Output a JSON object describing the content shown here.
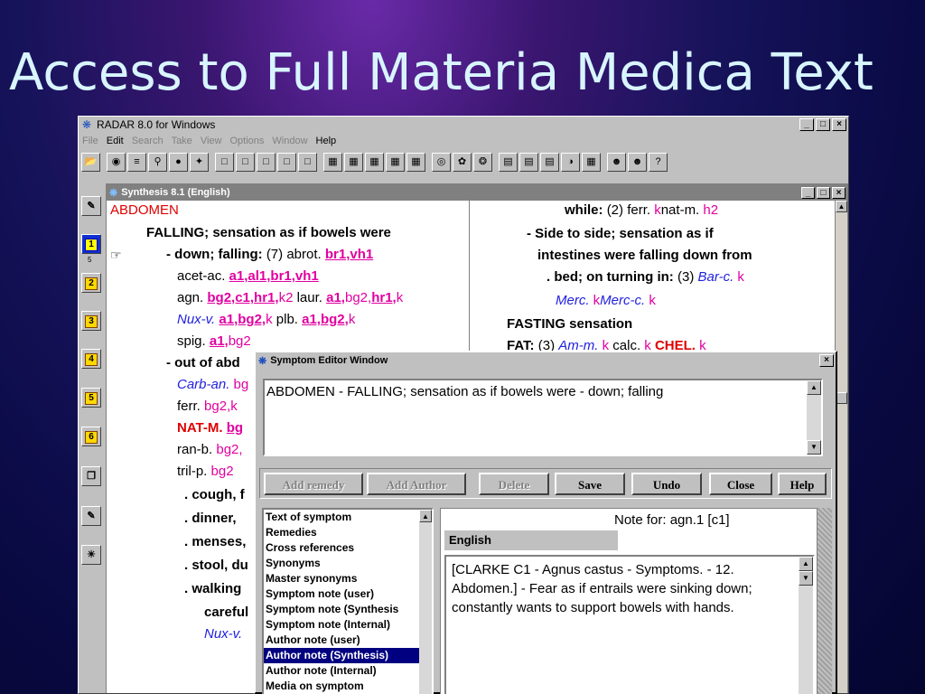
{
  "slide": {
    "title": "Access to Full Materia Medica Text"
  },
  "app": {
    "title": "RADAR 8.0 for Windows",
    "controls": [
      "_",
      "□",
      "×"
    ],
    "menu": [
      {
        "label": "File",
        "enabled": false
      },
      {
        "label": "Edit",
        "enabled": true
      },
      {
        "label": "Search",
        "enabled": false
      },
      {
        "label": "Take",
        "enabled": false
      },
      {
        "label": "View",
        "enabled": false
      },
      {
        "label": "Options",
        "enabled": false
      },
      {
        "label": "Window",
        "enabled": false
      },
      {
        "label": "Help",
        "enabled": true
      }
    ],
    "left_toolbar": [
      "1",
      "5",
      "2",
      "3",
      "4",
      "5",
      "6"
    ]
  },
  "synthesis": {
    "title": "Synthesis 8.1 (English)",
    "left": {
      "heading": "ABDOMEN",
      "line1": "FALLING; sensation as if bowels were",
      "line2_label": "- down; falling:",
      "line2_count": "(7)",
      "line2_rem": "abrot.",
      "line2_refs": "br1,vh1",
      "r1_rem": "acet-ac.",
      "r1_refs": "a1,al1,br1,vh1",
      "r2_rem": "agn.",
      "r2_refs": "bg2,c1,hr1,",
      "r2_k": "k2",
      "r2_rem2": "laur.",
      "r2_refs2": "a1,",
      "r2_plain": "bg2,",
      "r2_refs3": "hr1,",
      "r2_k2": "k",
      "r3_rem": "Nux-v.",
      "r3_refs": "a1,bg2,",
      "r3_k": "k",
      "r3_rem2": "plb.",
      "r3_refs2": "a1,bg2,",
      "r3_k2": "k",
      "r4_rem": "spig.",
      "r4_refs": "a1,",
      "r4_plain": "bg2",
      "line_out": "- out of abd",
      "r5_rem": "Carb-an.",
      "r5_plain": "bg",
      "r6_rem": "ferr.",
      "r6_plain": "bg2,k",
      "r7_rem": "NAT-M.",
      "r7_refs": "bg",
      "r8_rem": "ran-b.",
      "r8_plain": "bg2,",
      "r9_rem": "tril-p.",
      "r9_plain": "bg2",
      "sub1": ". cough, f",
      "sub2": ". dinner, ",
      "sub3": ". menses,",
      "sub4": ". stool, du",
      "sub5": ". walking",
      "sub6": "careful",
      "sub7": "Nux-v."
    },
    "right": {
      "l1_label": "while:",
      "l1_count": "(2)",
      "l1_rem": "ferr.",
      "l1_k": "k",
      "l1_rem2": "nat-m.",
      "l1_h": "h2",
      "l2": "- Side to side; sensation as if",
      "l3": "intestines were falling down from",
      "l4_label": ". bed; on turning in:",
      "l4_count": "(3)",
      "l4_rem": "Bar-c.",
      "l4_k": "k",
      "l5_rem": "Merc.",
      "l5_k": "k",
      "l5_rem2": "Merc-c.",
      "l5_k2": "k",
      "l6": "FASTING sensation",
      "l7_label": "FAT:",
      "l7_count": "(3)",
      "l7_rem": "Am-m.",
      "l7_k": "k",
      "l7_rem2": "calc.",
      "l7_k2": "k",
      "l7_rem3": "CHEL.",
      "l7_k3": "k"
    }
  },
  "symptom_editor": {
    "title": "Symptom Editor Window",
    "text": "ABDOMEN - FALLING; sensation as if bowels were - down; falling",
    "buttons": [
      {
        "label": "Add remedy",
        "enabled": false
      },
      {
        "label": "Add Author",
        "enabled": false
      },
      {
        "label": "Delete",
        "enabled": false
      },
      {
        "label": "Save",
        "enabled": true
      },
      {
        "label": "Undo",
        "enabled": true
      },
      {
        "label": "Close",
        "enabled": true
      },
      {
        "label": "Help",
        "enabled": true
      }
    ],
    "list_items": [
      "Text of symptom",
      "Remedies",
      "Cross references",
      "Synonyms",
      "Master synonyms",
      "Symptom note (user)",
      "Symptom note (Synthesis",
      "Symptom note (Internal)",
      "Author note (user)",
      "Author note (Synthesis)",
      "Author note (Internal)",
      "Media on symptom"
    ],
    "selected_index": 9,
    "note_for": "Note for: agn.1 [c1]",
    "language": "English",
    "note_text": "[CLARKE C1 - Agnus castus - Symptoms. - 12. Abdomen.] - Fear as if entrails were sinking down; constantly wants to support bowels with hands."
  }
}
